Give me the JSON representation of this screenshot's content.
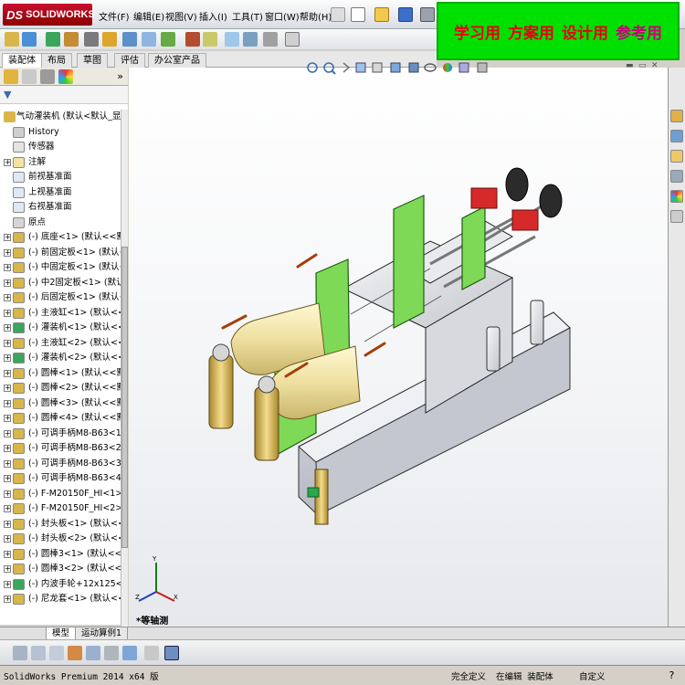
{
  "app": {
    "brand": "SOLIDWORKS"
  },
  "menu": [
    {
      "label": "文件(F)"
    },
    {
      "label": "编辑(E)"
    },
    {
      "label": "视图(V)"
    },
    {
      "label": "插入(I)"
    },
    {
      "label": "工具(T)"
    },
    {
      "label": "窗口(W)"
    },
    {
      "label": "帮助(H)"
    }
  ],
  "banner": {
    "items": [
      "学习用",
      "方案用",
      "设计用",
      "参考用"
    ]
  },
  "command_tabs": [
    {
      "label": "装配体"
    },
    {
      "label": "布局"
    },
    {
      "label": "草图"
    },
    {
      "label": "评估"
    },
    {
      "label": "办公室产品"
    }
  ],
  "tree": {
    "root": "气动灌装机 (默认<默认_显示",
    "rows": [
      {
        "label": "History",
        "expand": false,
        "icon": "history-icon"
      },
      {
        "label": "传感器",
        "expand": false,
        "icon": "sensor-icon"
      },
      {
        "label": "注解",
        "expand": true,
        "icon": "annotation-icon"
      },
      {
        "label": "前视基准面",
        "expand": false,
        "icon": "plane-icon"
      },
      {
        "label": "上视基准面",
        "expand": false,
        "icon": "plane-icon"
      },
      {
        "label": "右视基准面",
        "expand": false,
        "icon": "plane-icon"
      },
      {
        "label": "原点",
        "expand": false,
        "icon": "origin-icon"
      },
      {
        "label": "(-) 底座<1> (默认<<默认",
        "expand": true,
        "icon": "part-icon"
      },
      {
        "label": "(-) 前固定板<1> (默认<<",
        "expand": true,
        "icon": "part-icon"
      },
      {
        "label": "(-) 中固定板<1> (默认<<",
        "expand": true,
        "icon": "part-icon"
      },
      {
        "label": "(-) 中2固定板<1> (默认<",
        "expand": true,
        "icon": "part-icon"
      },
      {
        "label": "(-) 后固定板<1> (默认<<",
        "expand": true,
        "icon": "part-icon"
      },
      {
        "label": "(-) 主液缸<1> (默认<<默",
        "expand": true,
        "icon": "part-icon"
      },
      {
        "label": "(-) 灌装机<1> (默认<<默",
        "expand": true,
        "icon": "subassembly-icon"
      },
      {
        "label": "(-) 主液缸<2> (默认<<默",
        "expand": true,
        "icon": "part-icon"
      },
      {
        "label": "(-) 灌装机<2> (默认<<默",
        "expand": true,
        "icon": "subassembly-icon"
      },
      {
        "label": "(-) 圆棒<1> (默认<<默",
        "expand": true,
        "icon": "part-icon"
      },
      {
        "label": "(-) 圆棒<2> (默认<<默",
        "expand": true,
        "icon": "part-icon"
      },
      {
        "label": "(-) 圆棒<3> (默认<<默",
        "expand": true,
        "icon": "part-icon"
      },
      {
        "label": "(-) 圆棒<4> (默认<<默",
        "expand": true,
        "icon": "part-icon"
      },
      {
        "label": "(-) 可调手柄M8-B63<1>",
        "expand": true,
        "icon": "part-icon"
      },
      {
        "label": "(-) 可调手柄M8-B63<2> (",
        "expand": true,
        "icon": "part-icon"
      },
      {
        "label": "(-) 可调手柄M8-B63<3> (",
        "expand": true,
        "icon": "part-icon"
      },
      {
        "label": "(-) 可调手柄M8-B63<4> (",
        "expand": true,
        "icon": "part-icon"
      },
      {
        "label": "(-) F-M20150F_HI<1> (默",
        "expand": true,
        "icon": "part-icon"
      },
      {
        "label": "(-) F-M20150F_HI<2> (默",
        "expand": true,
        "icon": "part-icon"
      },
      {
        "label": "(-) 封头板<1> (默认<<默",
        "expand": true,
        "icon": "part-icon"
      },
      {
        "label": "(-) 封头板<2> (默认<<默",
        "expand": true,
        "icon": "part-icon"
      },
      {
        "label": "(-) 圆棒3<1> (默认<<默认",
        "expand": true,
        "icon": "part-icon"
      },
      {
        "label": "(-) 圆棒3<2> (默认<<默认",
        "expand": true,
        "icon": "part-icon"
      },
      {
        "label": "(-) 内波手轮+12x125<1> (",
        "expand": true,
        "icon": "subassembly-icon"
      },
      {
        "label": "(-) 尼龙套<1> (默认<<默",
        "expand": true,
        "icon": "part-icon"
      }
    ]
  },
  "viewport": {
    "view_label": "*等轴测"
  },
  "bottom_tabs": [
    {
      "label": "模型"
    },
    {
      "label": "运动算例1"
    }
  ],
  "status": {
    "product": "SolidWorks Premium 2014 x64 版",
    "under_defined": "完全定义",
    "editing": "在编辑 装配体",
    "custom": "自定义"
  },
  "colors": {
    "banner_bg": "#00e000",
    "banner_text": "#e60012",
    "plate_green": "#7ed957",
    "handle_orange": "#e86a1a",
    "cylinder_cream": "#f3e7a9"
  }
}
